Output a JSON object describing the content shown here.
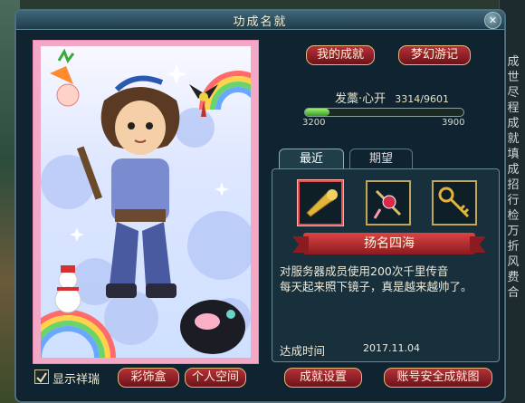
{
  "window": {
    "title": "功成名就",
    "close_label": "✕"
  },
  "background_right": {
    "chars": [
      "成",
      "世",
      "尽",
      "程",
      "成",
      "就",
      "填",
      "成",
      "招",
      "行",
      "检",
      "万",
      "折",
      "风",
      "费",
      "合"
    ]
  },
  "portrait": {
    "icons": [
      "carrot-icon",
      "rainbow-icon",
      "kite-bird-icon",
      "snowman-icon",
      "penguin-icon",
      "hero-character"
    ]
  },
  "header_buttons": {
    "my_achievements": "我的成就",
    "dream_journey": "梦幻游记"
  },
  "stats": {
    "name": "发藁·心开",
    "score": "3314/9601",
    "progress_fraction": 0.155,
    "range_start": "3200",
    "range_end": "3900"
  },
  "tabs": [
    {
      "label": "最近",
      "active": true
    },
    {
      "label": "期望",
      "active": false
    }
  ],
  "recent_items": [
    {
      "name": "golden-horn-icon",
      "selected": true
    },
    {
      "name": "ruby-brooch-icon",
      "selected": false
    },
    {
      "name": "golden-key-icon",
      "selected": false
    }
  ],
  "achievement": {
    "title": "扬名四海",
    "description_line1": "对服务器成员使用200次千里传音",
    "description_line2": "每天起来照下镜子，真是越来越帅了。",
    "completed_label": "达成时间",
    "completed_date": "2017.11.04"
  },
  "bottom": {
    "show_details_label": "显示祥瑞",
    "show_details_checked": true,
    "decor_box": "彩饰盒",
    "personal_space": "个人空间",
    "achievement_settings": "成就设置",
    "account_security": "账号安全成就图"
  },
  "colors": {
    "accent_red": "#9b1f26",
    "panel_bg": "#18303b",
    "progress_green": "#6fd24a",
    "frame_pink": "#f3a8c6"
  }
}
